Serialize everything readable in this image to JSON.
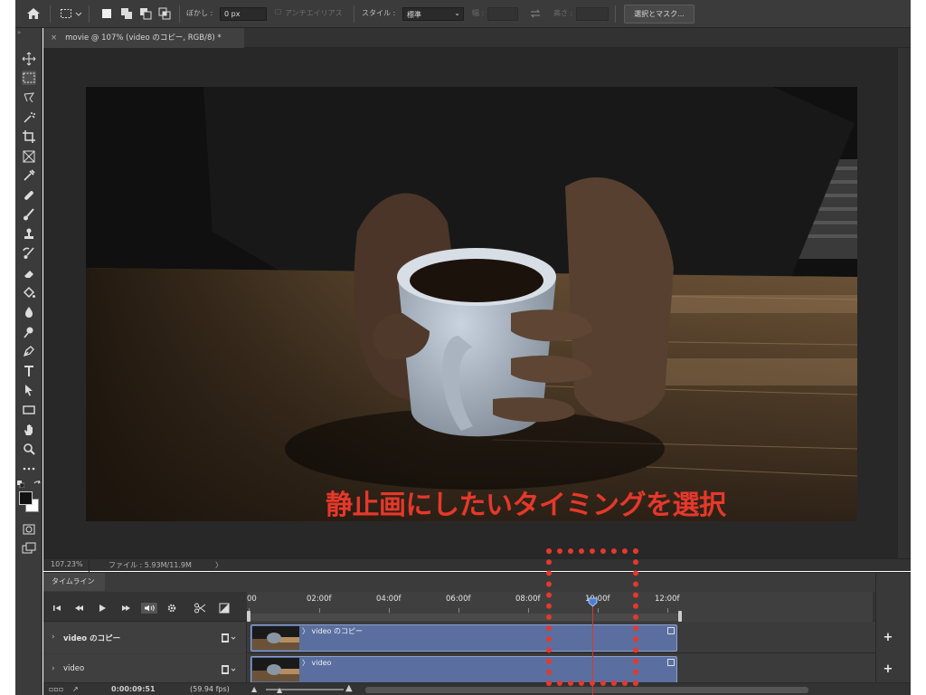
{
  "options_bar": {
    "feather_label": "ぼかし :",
    "feather_value": "0 px",
    "antialias_label": "アンチエイリアス",
    "style_label": "スタイル :",
    "style_value": "標準",
    "width_label": "幅 :",
    "height_label": "高さ :",
    "select_mask_button": "選択とマスク..."
  },
  "document_tab": {
    "title": "movie @ 107% (video のコピー, RGB/8) *"
  },
  "canvas": {
    "caption": "静止画にしたいタイミングを選択"
  },
  "status_bar": {
    "zoom": "107.23%",
    "file_info": "ファイル : 5.93M/11.9M",
    "arrow": "〉"
  },
  "timeline": {
    "tab_label": "タイムライン",
    "ruler_labels": [
      "00",
      "02:00f",
      "04:00f",
      "06:00f",
      "08:00f",
      "10:00f",
      "12:00f"
    ],
    "tracks": [
      {
        "name": "video のコピー",
        "clip_label": "video のコピー"
      },
      {
        "name": "video",
        "clip_label": "video"
      }
    ],
    "current_time": "0:00:09:51",
    "fps": "(59.94 fps)"
  },
  "colors": {
    "accent_red": "#e6382b",
    "clip_blue": "#5a6fa0",
    "panel_bg": "#3b3b3b"
  }
}
